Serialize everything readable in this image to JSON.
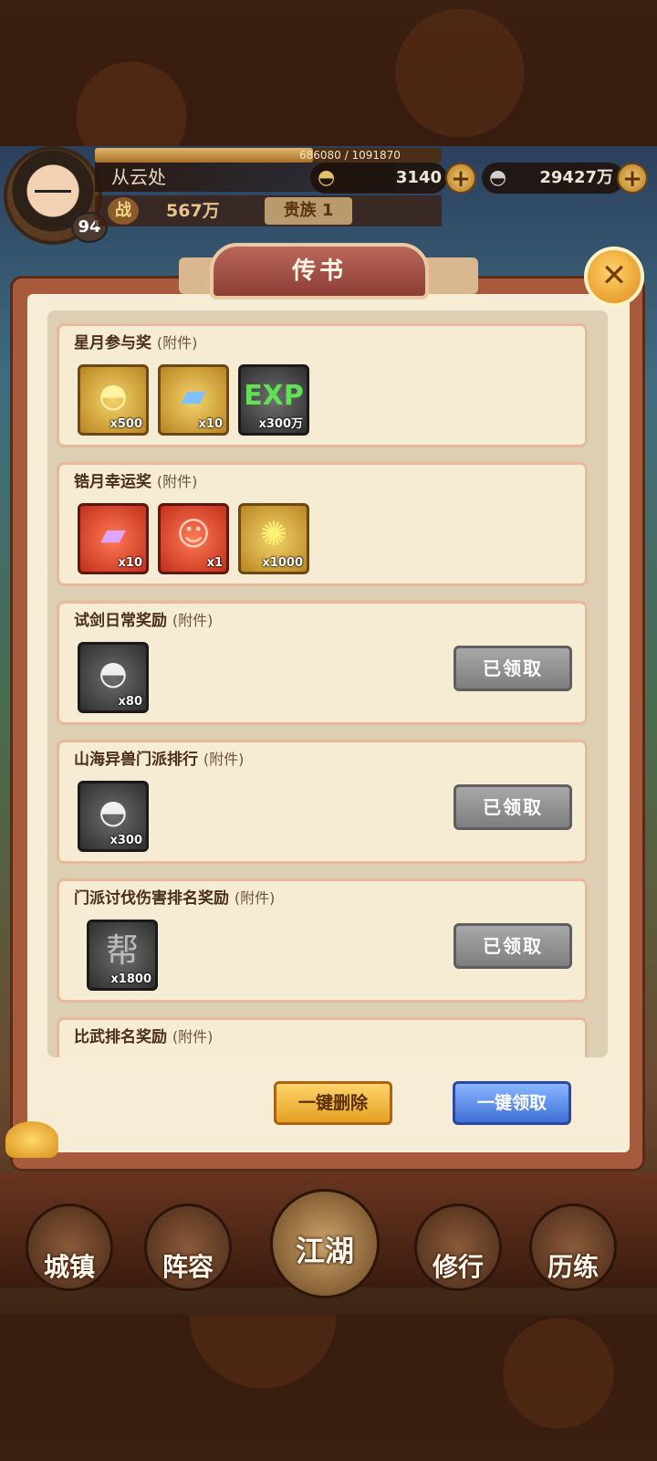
{
  "player": {
    "level": "94",
    "exp_text": "686080 / 1091870",
    "exp_progress": 0.628,
    "name": "从云处",
    "combat_label": "战",
    "combat_power": "567万",
    "rank": "贵族 1"
  },
  "currencies": [
    {
      "icon": "ingot-gold-icon",
      "value": "3140"
    },
    {
      "icon": "ingot-silver-icon",
      "value": "29427万"
    }
  ],
  "dialog": {
    "title": "传书",
    "attach_label": "(附件)",
    "mails": [
      {
        "title": "星月参与奖",
        "claimed": false,
        "items": [
          {
            "icon": "gold-ingot-icon",
            "count": "x500",
            "frame": "gold"
          },
          {
            "icon": "blue-scroll-icon",
            "count": "x10",
            "frame": "gold"
          },
          {
            "icon": "exp-orb-icon",
            "count": "x300万",
            "frame": "grey"
          }
        ]
      },
      {
        "title": "锆月幸运奖",
        "claimed": false,
        "items": [
          {
            "icon": "purple-scroll-icon",
            "count": "x10",
            "frame": "purple"
          },
          {
            "icon": "hero-shard-icon",
            "count": "x1",
            "frame": "purple"
          },
          {
            "icon": "golden-swirl-icon",
            "count": "x1000",
            "frame": "gold"
          }
        ]
      },
      {
        "title": "试剑日常奖励",
        "claimed": true,
        "items": [
          {
            "icon": "silver-ingot-icon",
            "count": "x80",
            "frame": "grey"
          }
        ]
      },
      {
        "title": "山海异兽门派排行",
        "claimed": true,
        "items": [
          {
            "icon": "silver-ingot-icon",
            "count": "x300",
            "frame": "grey"
          }
        ]
      },
      {
        "title": "门派讨伐伤害排名奖励",
        "claimed": true,
        "items": [
          {
            "icon": "guild-token-icon",
            "count": "x1800",
            "frame": "grey"
          }
        ]
      },
      {
        "title": "比武排名奖励",
        "claimed": false,
        "items": []
      }
    ],
    "claimed_label": "已领取",
    "delete_all_label": "一键删除",
    "claim_all_label": "一键领取"
  },
  "nav": {
    "items": [
      "城镇",
      "阵容",
      "江湖",
      "修行",
      "历练"
    ]
  }
}
